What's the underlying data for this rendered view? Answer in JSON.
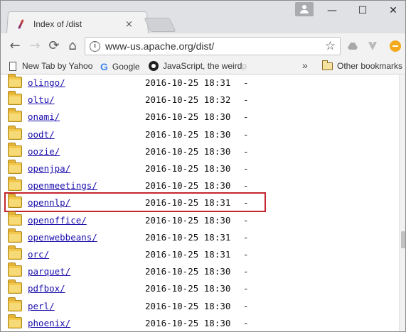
{
  "browser": {
    "tab_title": "Index of /dist",
    "tab_close": "×",
    "window_minimize": "—",
    "window_maximize": "☐",
    "window_close": "✕",
    "url": "www-us.apache.org/dist/",
    "nav": {
      "back": "←",
      "forward": "→",
      "reload": "⟳",
      "home": "⌂"
    },
    "star": "☆",
    "info": "i"
  },
  "bookmarks": {
    "items": [
      {
        "label": "New Tab by Yahoo",
        "icon": "page-icon"
      },
      {
        "label": "Google",
        "icon": "google-icon",
        "glyph": "G"
      },
      {
        "label": "JavaScript, the weird ",
        "fade": "p",
        "icon": "javascript-icon"
      }
    ],
    "more": "»",
    "other_label": "Other bookmarks"
  },
  "listing": {
    "entries": [
      {
        "name": "olingo/",
        "date": "2016-10-25 18:31",
        "size": "-"
      },
      {
        "name": "oltu/",
        "date": "2016-10-25 18:32",
        "size": "-"
      },
      {
        "name": "onami/",
        "date": "2016-10-25 18:30",
        "size": "-"
      },
      {
        "name": "oodt/",
        "date": "2016-10-25 18:30",
        "size": "-"
      },
      {
        "name": "oozie/",
        "date": "2016-10-25 18:30",
        "size": "-"
      },
      {
        "name": "openjpa/",
        "date": "2016-10-25 18:30",
        "size": "-"
      },
      {
        "name": "openmeetings/",
        "date": "2016-10-25 18:30",
        "size": "-"
      },
      {
        "name": "opennlp/",
        "date": "2016-10-25 18:31",
        "size": "-"
      },
      {
        "name": "openoffice/",
        "date": "2016-10-25 18:30",
        "size": "-"
      },
      {
        "name": "openwebbeans/",
        "date": "2016-10-25 18:31",
        "size": "-"
      },
      {
        "name": "orc/",
        "date": "2016-10-25 18:31",
        "size": "-"
      },
      {
        "name": "parquet/",
        "date": "2016-10-25 18:30",
        "size": "-"
      },
      {
        "name": "pdfbox/",
        "date": "2016-10-25 18:30",
        "size": "-"
      },
      {
        "name": "perl/",
        "date": "2016-10-25 18:30",
        "size": "-"
      },
      {
        "name": "phoenix/",
        "date": "2016-10-25 18:30",
        "size": "-"
      }
    ],
    "highlighted_entry": "opennlp/",
    "highlight_color": "#c3262e",
    "link_color": "#1a0dab"
  }
}
